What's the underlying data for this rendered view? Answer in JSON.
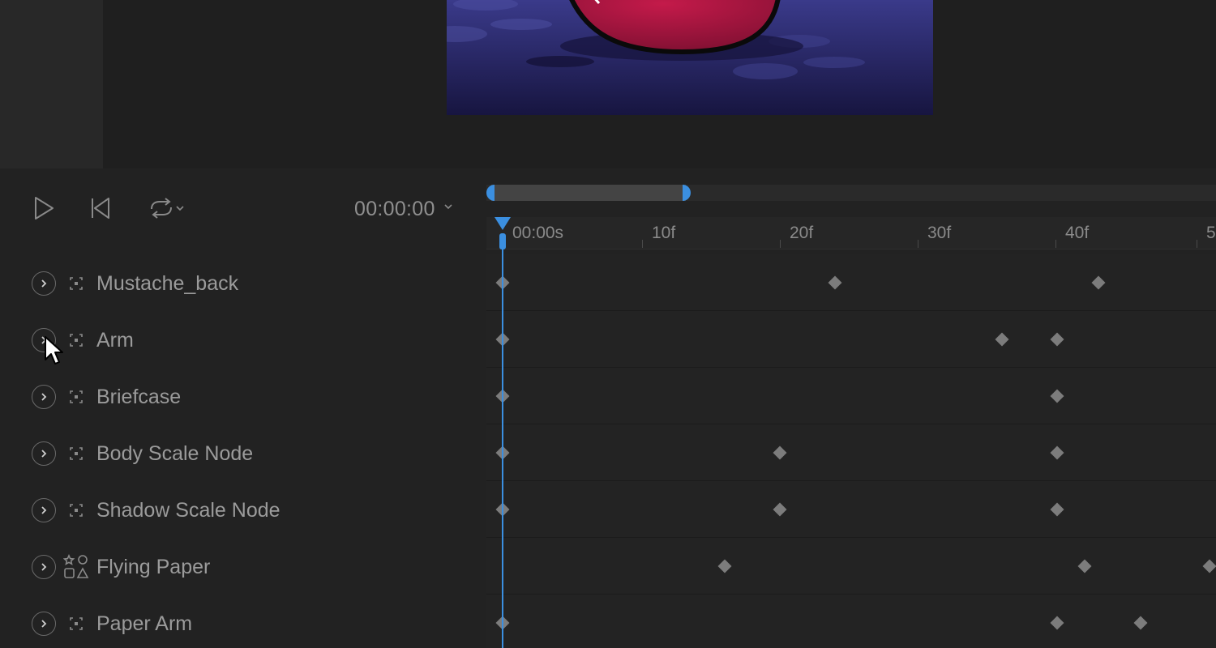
{
  "colors": {
    "accent": "#3b8fe0",
    "keyframe": "#7c7c7c",
    "panel_bg": "#222222",
    "text": "#9b9b9b"
  },
  "preview": {
    "canvas_description_icon": "character-preview-image"
  },
  "transport": {
    "play_icon": "play-icon",
    "rewind_icon": "skip-to-start-icon",
    "loop_icon": "loop-icon",
    "timecode": "00:00:00"
  },
  "ruler": {
    "labels": [
      "00:00s",
      "10f",
      "20f",
      "30f",
      "40f",
      "5"
    ]
  },
  "layers": [
    {
      "name": "Mustache_back",
      "icon": "node-icon",
      "keyframes_frame": [
        0,
        24,
        43
      ]
    },
    {
      "name": "Arm",
      "icon": "node-icon",
      "keyframes_frame": [
        0,
        36,
        40
      ]
    },
    {
      "name": "Briefcase",
      "icon": "node-icon",
      "keyframes_frame": [
        0,
        40
      ]
    },
    {
      "name": "Body Scale Node",
      "icon": "node-icon",
      "keyframes_frame": [
        0,
        20,
        40
      ]
    },
    {
      "name": "Shadow Scale Node",
      "icon": "node-icon",
      "keyframes_frame": [
        0,
        20,
        40
      ]
    },
    {
      "name": "Flying Paper",
      "icon": "shapes-icon",
      "keyframes_frame": [
        16,
        42,
        51
      ]
    },
    {
      "name": "Paper Arm",
      "icon": "node-icon",
      "keyframes_frame": [
        0,
        40,
        46
      ]
    }
  ],
  "playhead_frame": 0
}
